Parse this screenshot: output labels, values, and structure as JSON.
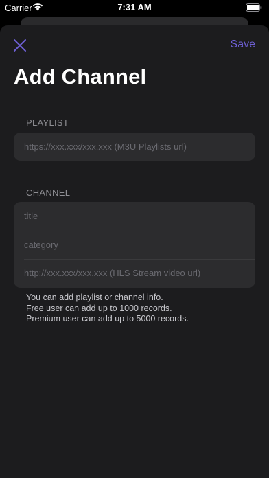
{
  "status_bar": {
    "carrier": "Carrier",
    "time": "7:31 AM"
  },
  "nav": {
    "save_label": "Save",
    "close_icon": "close-icon",
    "accent_color": "#6d5fd3"
  },
  "title": "Add Channel",
  "playlist_section": {
    "header": "PLAYLIST",
    "url_placeholder": "https://xxx.xxx/xxx.xxx (M3U Playlists url)"
  },
  "channel_section": {
    "header": "CHANNEL",
    "title_placeholder": "title",
    "category_placeholder": "category",
    "url_placeholder": "http://xxx.xxx/xxx.xxx (HLS Stream video url)"
  },
  "footer": {
    "line1": "You can add playlist or channel info.",
    "line2": "Free user can add up to 1000 records.",
    "line3": "Premium user can add up to 5000 records."
  }
}
